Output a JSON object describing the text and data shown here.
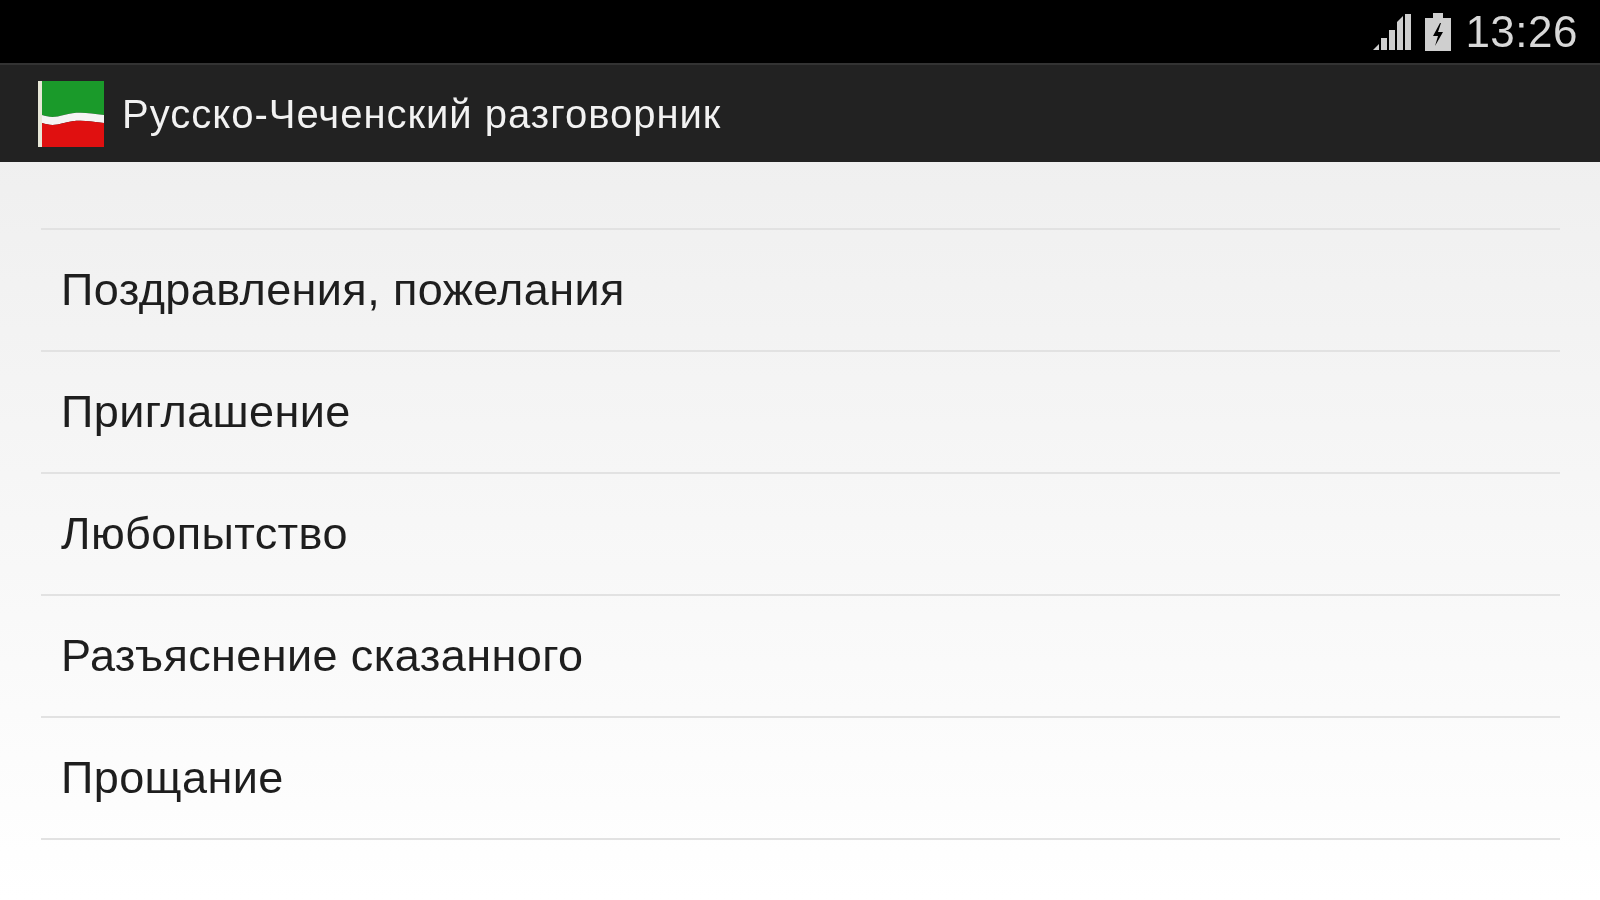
{
  "status_bar": {
    "time": "13:26"
  },
  "app_bar": {
    "title": "Русско-Чеченский разговорник"
  },
  "topics": [
    {
      "label": "Поздравления, пожелания"
    },
    {
      "label": "Приглашение"
    },
    {
      "label": "Любопытство"
    },
    {
      "label": "Разъяснение сказанного"
    },
    {
      "label": "Прощание"
    }
  ]
}
